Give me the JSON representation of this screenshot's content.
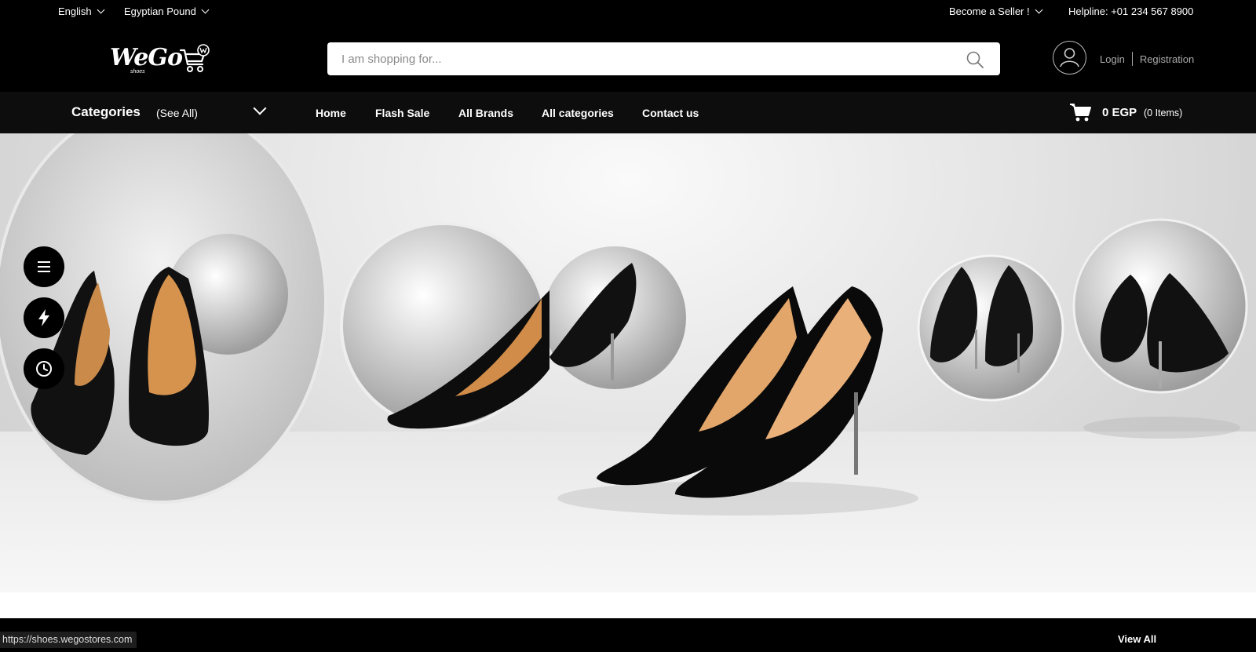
{
  "topbar": {
    "language": "English",
    "currency": "Egyptian Pound",
    "become_seller": "Become a Seller !",
    "helpline": "Helpline: +01 234 567 8900"
  },
  "header": {
    "logo_text": "WeGo",
    "logo_subtext": "shoes",
    "search": {
      "placeholder": "I am shopping for..."
    },
    "login_label": "Login",
    "registration_label": "Registration"
  },
  "nav": {
    "categories_label": "Categories",
    "see_all_label": "(See All)",
    "links": [
      {
        "label": "Home"
      },
      {
        "label": "Flash Sale"
      },
      {
        "label": "All Brands"
      },
      {
        "label": "All categories"
      },
      {
        "label": "Contact us"
      }
    ],
    "cart": {
      "amount": "0 EGP",
      "items": "(0 Items)"
    }
  },
  "side_buttons": [
    {
      "icon": "menu-icon"
    },
    {
      "icon": "flash-icon"
    },
    {
      "icon": "clock-icon"
    }
  ],
  "section": {
    "view_all_label": "View All"
  },
  "status_bar": {
    "url": "https://shoes.wegostores.com"
  }
}
